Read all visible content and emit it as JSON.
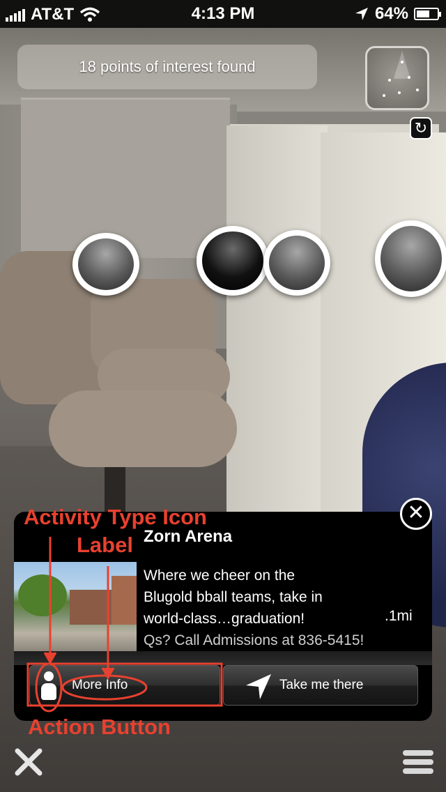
{
  "status_bar": {
    "carrier": "AT&T",
    "time": "4:13 PM",
    "battery": "64%",
    "battery_level": 0.64
  },
  "ar_view": {
    "poi_count_text": "18 points of interest found",
    "icons": {
      "radar": "radar-icon",
      "refresh": "refresh-icon"
    }
  },
  "panel": {
    "title": "Zorn Arena",
    "description_lines": [
      "Where we cheer on the",
      "Blugold bball teams, take in",
      "world-class…graduation!"
    ],
    "contact": "Qs? Call Admissions at 836-5415!",
    "distance": ".1mi",
    "buttons": {
      "more_info": "More Info",
      "take_me_there": "Take me there"
    }
  },
  "annotations": {
    "activity_type_icon": "Activity Type Icon",
    "label": "Label",
    "action_button": "Action Button",
    "color": "#e8412f"
  },
  "bottom_bar": {
    "icons": {
      "exit": "close-x-icon",
      "menu": "hamburger-menu-icon"
    }
  }
}
